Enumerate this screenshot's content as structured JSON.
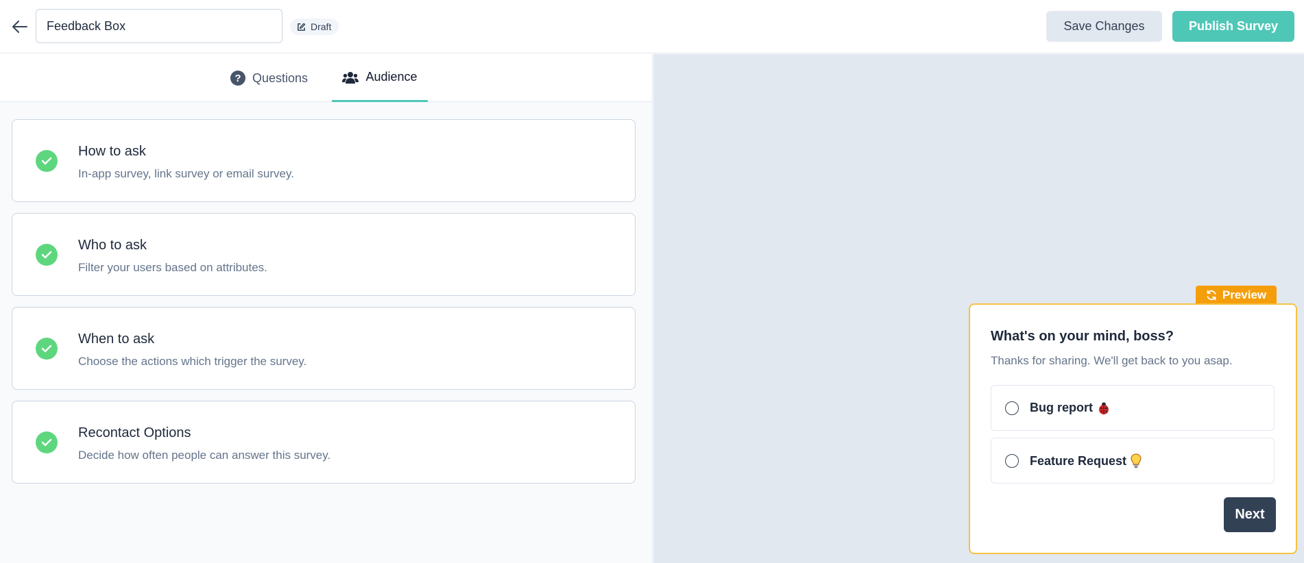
{
  "header": {
    "survey_name": "Feedback Box",
    "status_badge": "Draft",
    "save_label": "Save Changes",
    "publish_label": "Publish Survey"
  },
  "tabs": [
    {
      "label": "Questions",
      "icon": "question-circle-icon",
      "active": false
    },
    {
      "label": "Audience",
      "icon": "users-icon",
      "active": true
    }
  ],
  "audience_cards": [
    {
      "title": "How to ask",
      "description": "In-app survey, link survey or email survey.",
      "completed": true
    },
    {
      "title": "Who to ask",
      "description": "Filter your users based on attributes.",
      "completed": true
    },
    {
      "title": "When to ask",
      "description": "Choose the actions which trigger the survey.",
      "completed": true
    },
    {
      "title": "Recontact Options",
      "description": "Decide how often people can answer this survey.",
      "completed": true
    }
  ],
  "preview": {
    "tag_label": "Preview",
    "question": "What's on your mind, boss?",
    "subheader": "Thanks for sharing. We'll get back to you asap.",
    "options": [
      {
        "label": "Bug report",
        "emoji": "ladybug-icon"
      },
      {
        "label": "Feature Request",
        "emoji": "lightbulb-icon"
      }
    ],
    "next_label": "Next"
  },
  "colors": {
    "brand_teal": "#4fc7b7",
    "check_green": "#5ed67e",
    "preview_amber": "#f59e0b",
    "preview_border": "#f5c242",
    "dark_button": "#334155"
  }
}
